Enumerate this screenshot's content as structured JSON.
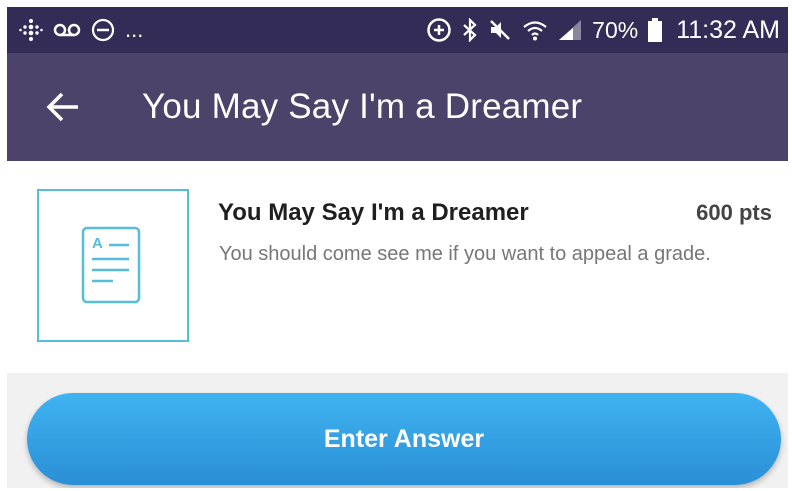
{
  "status_bar": {
    "left_icons": [
      "fitbit-icon",
      "voicemail-icon",
      "do-not-disturb-icon"
    ],
    "overflow_text": "...",
    "right_icons": [
      "data-saver-icon",
      "bluetooth-icon",
      "mute-icon",
      "wifi-icon",
      "signal-icon",
      "battery-icon"
    ],
    "battery_percent": "70%",
    "time": "11:32 AM"
  },
  "app_bar": {
    "title": "You May Say I'm a Dreamer",
    "back_icon": "arrow-back-icon",
    "color": "#4b4369"
  },
  "challenge": {
    "title": "You May Say I'm a Dreamer",
    "points": "600 pts",
    "description": "You should come see me if you want to appeal a grade.",
    "thumbnail_icon": "document-icon",
    "accent_color": "#56bddd"
  },
  "actions": {
    "enter_answer_label": "Enter Answer",
    "button_color": "#38a8ea"
  }
}
